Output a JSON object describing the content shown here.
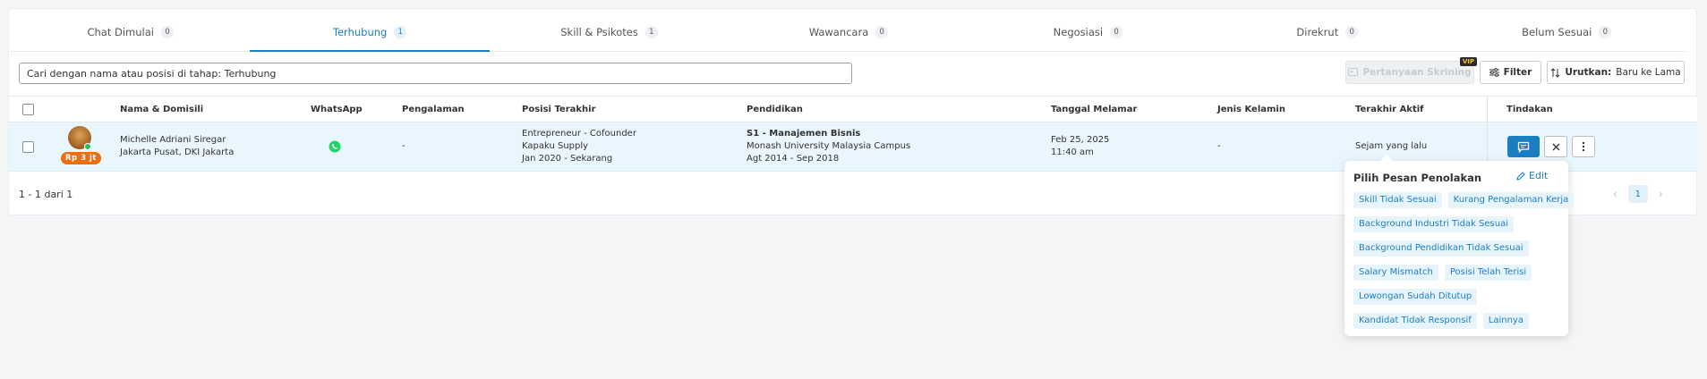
{
  "tabs": [
    {
      "label": "Chat Dimulai",
      "count": "0"
    },
    {
      "label": "Terhubung",
      "count": "1"
    },
    {
      "label": "Skill & Psikotes",
      "count": "1"
    },
    {
      "label": "Wawancara",
      "count": "0"
    },
    {
      "label": "Negosiasi",
      "count": "0"
    },
    {
      "label": "Direkrut",
      "count": "0"
    },
    {
      "label": "Belum Sesuai",
      "count": "0"
    }
  ],
  "search": {
    "placeholder": "Cari dengan nama atau posisi di tahap: Terhubung"
  },
  "toolbar": {
    "screening_label": "Pertanyaan Skrining",
    "vip_badge": "VIP",
    "filter_label": "Filter",
    "sort_label": "Urutkan:",
    "sort_value": "Baru ke Lama"
  },
  "table": {
    "headers": {
      "name": "Nama & Domisili",
      "whatsapp": "WhatsApp",
      "experience": "Pengalaman",
      "last_position": "Posisi Terakhir",
      "education": "Pendidikan",
      "applied_date": "Tanggal Melamar",
      "gender": "Jenis Kelamin",
      "last_active": "Terakhir Aktif",
      "actions": "Tindakan"
    },
    "row": {
      "salary_badge": "Rp 3 jt",
      "name": "Michelle Adriani Siregar",
      "domicile": "Jakarta Pusat, DKI Jakarta",
      "experience": "-",
      "position_title": "Entrepreneur - Cofounder",
      "position_company": "Kapaku Supply",
      "position_period": "Jan 2020 - Sekarang",
      "education_degree": "S1 - Manajemen Bisnis",
      "education_school": "Monash University Malaysia Campus",
      "education_period": "Agt 2014 - Sep 2018",
      "applied_date": "Feb 25, 2025",
      "applied_time": "11:40 am",
      "gender": "-",
      "last_active": "Sejam yang lalu"
    }
  },
  "pagination": {
    "summary": "1 - 1 dari 1",
    "current_page": "1"
  },
  "rejection_popover": {
    "title": "Pilih Pesan Penolakan",
    "edit_label": "Edit",
    "options": [
      [
        "Skill Tidak Sesuai",
        "Kurang Pengalaman Kerja"
      ],
      [
        "Background Industri Tidak Sesuai"
      ],
      [
        "Background Pendidikan Tidak Sesuai"
      ],
      [
        "Salary Mismatch",
        "Posisi Telah Terisi"
      ],
      [
        "Lowongan Sudah Ditutup"
      ],
      [
        "Kandidat Tidak Responsif",
        "Lainnya"
      ]
    ]
  },
  "colors": {
    "accent": "#1a7fc1",
    "salary_badge": "#ee6d0f",
    "whatsapp": "#25d366"
  }
}
